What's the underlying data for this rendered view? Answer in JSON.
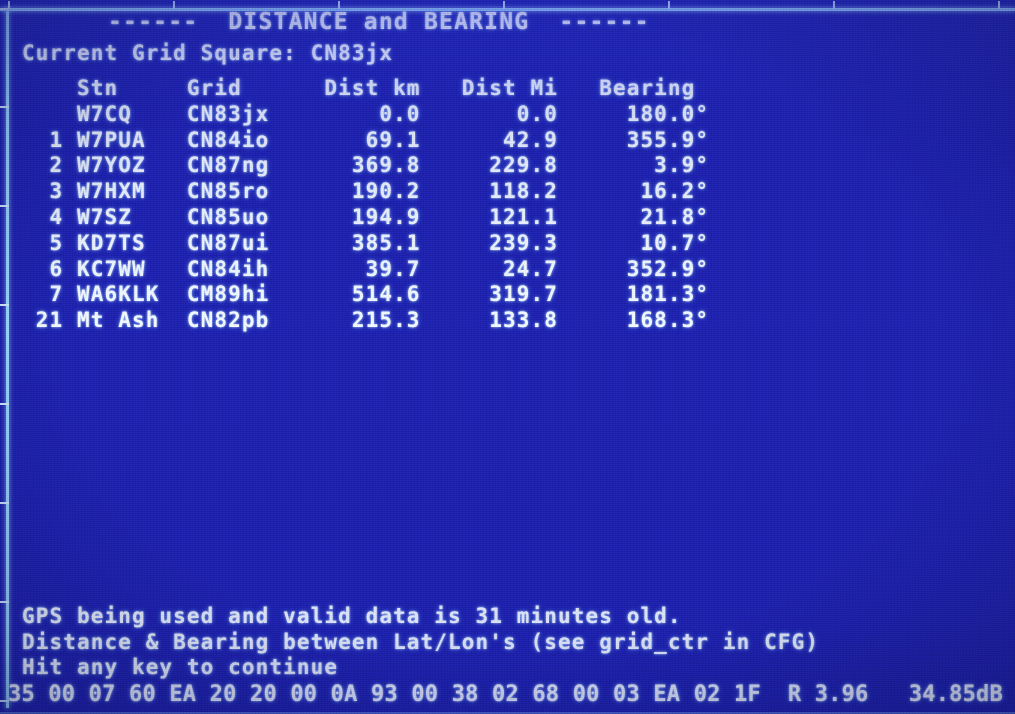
{
  "screen": {
    "title_line": "------  DISTANCE and BEARING  ------",
    "background_color": "#2024b2",
    "text_color": "#f2f8ff",
    "graticule_color": "#9fd8ff"
  },
  "header": {
    "current_grid_label": "Current Grid Square:",
    "current_grid_value": "CN83jx",
    "current_grid_line": "Current Grid Square: CN83jx"
  },
  "table": {
    "columns": [
      "",
      "Stn",
      "Grid",
      "Dist km",
      "Dist Mi",
      "Bearing"
    ],
    "header_line": "    Stn     Grid      Dist km   Dist Mi   Bearing",
    "rows": [
      {
        "idx": "",
        "stn": "W7CQ",
        "grid": "CN83jx",
        "dist_km": "0.0",
        "dist_mi": "0.0",
        "bearing": "180.0°",
        "line": "    W7CQ    CN83jx        0.0       0.0     180.0°"
      },
      {
        "idx": "1",
        "stn": "W7PUA",
        "grid": "CN84io",
        "dist_km": "69.1",
        "dist_mi": "42.9",
        "bearing": "355.9°",
        "line": "  1 W7PUA   CN84io       69.1      42.9     355.9°"
      },
      {
        "idx": "2",
        "stn": "W7YOZ",
        "grid": "CN87ng",
        "dist_km": "369.8",
        "dist_mi": "229.8",
        "bearing": "3.9°",
        "line": "  2 W7YOZ   CN87ng      369.8     229.8       3.9°"
      },
      {
        "idx": "3",
        "stn": "W7HXM",
        "grid": "CN85ro",
        "dist_km": "190.2",
        "dist_mi": "118.2",
        "bearing": "16.2°",
        "line": "  3 W7HXM   CN85ro      190.2     118.2      16.2°"
      },
      {
        "idx": "4",
        "stn": "W7SZ",
        "grid": "CN85uo",
        "dist_km": "194.9",
        "dist_mi": "121.1",
        "bearing": "21.8°",
        "line": "  4 W7SZ    CN85uo      194.9     121.1      21.8°"
      },
      {
        "idx": "5",
        "stn": "KD7TS",
        "grid": "CN87ui",
        "dist_km": "385.1",
        "dist_mi": "239.3",
        "bearing": "10.7°",
        "line": "  5 KD7TS   CN87ui      385.1     239.3      10.7°"
      },
      {
        "idx": "6",
        "stn": "KC7WW",
        "grid": "CN84ih",
        "dist_km": "39.7",
        "dist_mi": "24.7",
        "bearing": "352.9°",
        "line": "  6 KC7WW   CN84ih       39.7      24.7     352.9°"
      },
      {
        "idx": "7",
        "stn": "WA6KLK",
        "grid": "CM89hi",
        "dist_km": "514.6",
        "dist_mi": "319.7",
        "bearing": "181.3°",
        "line": "  7 WA6KLK  CM89hi      514.6     319.7     181.3°"
      },
      {
        "idx": "21",
        "stn": "Mt Ash",
        "grid": "CN82pb",
        "dist_km": "215.3",
        "dist_mi": "133.8",
        "bearing": "168.3°",
        "line": " 21 Mt Ash  CN82pb      215.3     133.8     168.3°"
      }
    ]
  },
  "status": {
    "line1": "GPS being used and valid data is 31 minutes old.",
    "line2": "Distance & Bearing between Lat/Lon's (see grid_ctr in CFG)",
    "line3": "Hit any key to continue",
    "gps_minutes_old": "31"
  },
  "footer": {
    "hex_bytes": "35 00 07 60 EA 20 20 00 0A 93 00 38 02 68 00 03 EA 02 1F",
    "r_label": "R",
    "r_value": "3.96",
    "db_value": "34.85dB",
    "line": "35 00 07 60 EA 20 20 00 0A 93 00 38 02 68 00 03 EA 02 1F  R 3.96   34.85dB"
  }
}
